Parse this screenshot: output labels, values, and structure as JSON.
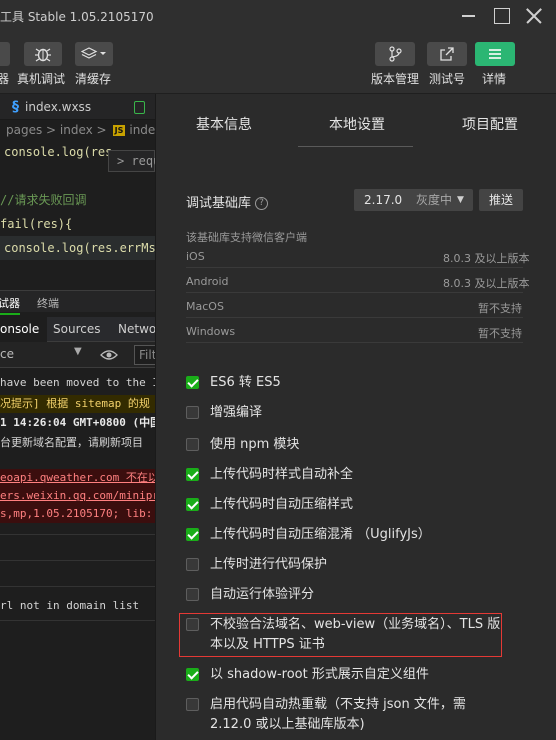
{
  "window": {
    "title": "工具 Stable 1.05.2105170",
    "controls": [
      "minimize-icon",
      "maximize-icon",
      "close-icon"
    ]
  },
  "toolbar": {
    "left_label_1": "器",
    "left_label_2": "真机调试",
    "left_label_3": "清缓存",
    "right_labels": [
      "版本管理",
      "测试号",
      "详情"
    ],
    "icons": [
      "bug-icon",
      "layers-icon",
      "branch-icon",
      "share-icon",
      "menu-icon"
    ]
  },
  "editor": {
    "tabs": [
      "index.wxss"
    ],
    "breadcrumb": "pages > index > ",
    "breadcrumb_file": "index",
    "js_badge": "JS",
    "lines": [
      {
        "text": "console.log(res.",
        "type": "code"
      },
      {
        "text": "//请求失败回调",
        "type": "comment"
      },
      {
        "text": "fail(res){",
        "type": "code"
      },
      {
        "text": "console.log(res.errMsg)",
        "type": "code"
      }
    ],
    "suggest": "> requ"
  },
  "debugger": {
    "tabs": [
      "试器",
      "终端"
    ],
    "panel_tabs": [
      "onsole",
      "Sources",
      "Netwo"
    ],
    "filter_context": "ce",
    "filter_placeholder": "Filt",
    "messages": [
      {
        "text": "have been moved to the I",
        "level": "info"
      },
      {
        "text": "况提示] 根据 sitemap 的规",
        "level": "warn"
      },
      {
        "text": "1 14:26:04 GMT+0800 (中国",
        "level": "info"
      },
      {
        "text": "台更新域名配置，请刷新项目",
        "level": "info"
      },
      {
        "text": "eoapi.qweather.com 不在以",
        "level": "error"
      },
      {
        "text": "ers.weixin.qq.com/minipr",
        "level": "error"
      },
      {
        "text": "s,mp,1.05.2105170; lib:",
        "level": "error"
      },
      {
        "text": "rl not in domain list",
        "level": "info"
      }
    ]
  },
  "settings": {
    "tabs": [
      "基本信息",
      "本地设置",
      "项目配置"
    ],
    "active_tab": "本地设置",
    "base_lib_label": "调试基础库",
    "base_lib_help": "?",
    "base_lib_version": "2.17.0",
    "base_lib_status": "灰度中",
    "push_button": "推送",
    "support_title": "该基础库支持微信客户端",
    "platforms": [
      {
        "name": "iOS",
        "support": "8.0.3 及以上版本"
      },
      {
        "name": "Android",
        "support": "8.0.3 及以上版本"
      },
      {
        "name": "MacOS",
        "support": "暂不支持"
      },
      {
        "name": "Windows",
        "support": "暂不支持"
      }
    ],
    "options": [
      {
        "label": "ES6 转 ES5",
        "checked": true
      },
      {
        "label": "增强编译",
        "checked": false
      },
      {
        "label": "使用 npm 模块",
        "checked": false
      },
      {
        "label": "上传代码时样式自动补全",
        "checked": true
      },
      {
        "label": "上传代码时自动压缩样式",
        "checked": true
      },
      {
        "label": "上传代码时自动压缩混淆 （UglifyJs）",
        "checked": true
      },
      {
        "label": "上传时进行代码保护",
        "checked": false
      },
      {
        "label": "自动运行体验评分",
        "checked": false
      },
      {
        "label": "不校验合法域名、web-view（业务域名）、TLS 版本以及 HTTPS 证书",
        "checked": false
      },
      {
        "label": "以 shadow-root 形式展示自定义组件",
        "checked": true
      },
      {
        "label": "启用代码自动热重载（不支持 json 文件，需 2.12.0 或以上基础库版本)",
        "checked": false
      }
    ]
  },
  "colors": {
    "accent_green": "#1aad19",
    "highlight_red": "#e53935"
  }
}
